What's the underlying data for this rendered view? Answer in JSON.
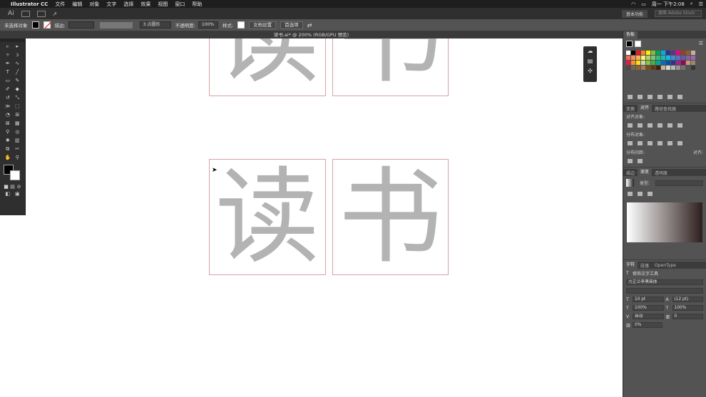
{
  "menubar": {
    "apple": "",
    "app": "Illustrator CC",
    "items": [
      "文件",
      "编辑",
      "对象",
      "文字",
      "选择",
      "效果",
      "视图",
      "窗口",
      "帮助"
    ],
    "clock": "周一 下午2:08"
  },
  "appbar": {
    "logo": "Ai",
    "workspace": "基本功能",
    "search_placeholder": "搜索 Adobe Stock"
  },
  "control": {
    "selection_status": "未选择对象",
    "stroke_label": "描边:",
    "brush": "3 点圆形",
    "opacity_label": "不透明度:",
    "opacity_value": "100%",
    "style_label": "样式:",
    "doc_setup": "文档设置",
    "preferences": "首选项"
  },
  "document": {
    "tab_title": "读书.ai* @ 200% (RGB/GPU 预览)"
  },
  "canvas": {
    "char_a": "读",
    "char_b": "书"
  },
  "swatches": {
    "tab": "色板",
    "colors": [
      "#ffffff",
      "#000000",
      "#e51b24",
      "#f58220",
      "#fff200",
      "#7ac143",
      "#00a651",
      "#00aeef",
      "#2e3192",
      "#662d91",
      "#ec008c",
      "#a0410d",
      "#8b5e3c",
      "#c7b299",
      "#f26c4f",
      "#f68e56",
      "#fbaf5d",
      "#fff467",
      "#acd372",
      "#7cc576",
      "#3bb878",
      "#1abbb4",
      "#00bff3",
      "#438ccb",
      "#5574b9",
      "#605ca8",
      "#855fa8",
      "#a763a8",
      "#ed145b",
      "#f7941d",
      "#ffde17",
      "#c4df9b",
      "#8dc63f",
      "#39b54a",
      "#00a99d",
      "#0072bc",
      "#0054a6",
      "#2e3192",
      "#92278f",
      "#9e005d",
      "#c69c6d",
      "#998675",
      "#534741",
      "#736357",
      "#8c6239",
      "#a67c52",
      "#754c24",
      "#603913",
      "#42210b",
      "#c2b59b",
      "#d7d7d7",
      "#b7b7b7",
      "#959595",
      "#737373",
      "#555555",
      "#363636"
    ]
  },
  "align": {
    "tabs": [
      "变换",
      "对齐",
      "路径查找器"
    ],
    "align_objects": "对齐对象:",
    "distribute_objects": "分布对象:",
    "distribute_spacing": "分布间距:",
    "align_to": "对齐:"
  },
  "gradient": {
    "tabs": [
      "描边",
      "渐变",
      "透明度"
    ],
    "type_label": "类型:"
  },
  "character": {
    "tabs": [
      "字符",
      "段落",
      "OpenType"
    ],
    "touch_tool": "修饰文字工具",
    "font": "方正兰亭黑简体",
    "size": "10 pt",
    "leading": "(12 pt)",
    "hscale": "100%",
    "vscale": "100%",
    "kerning": "自动",
    "tracking": "0",
    "tsume": "0%"
  }
}
